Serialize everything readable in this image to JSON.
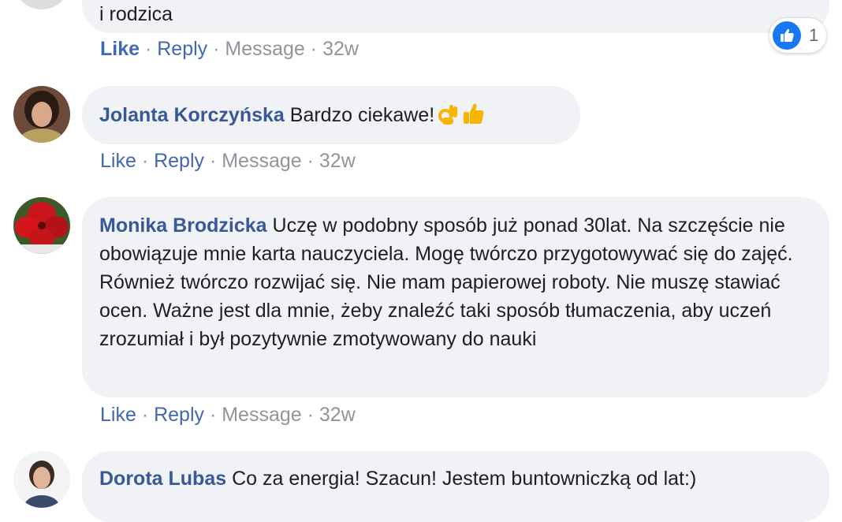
{
  "comments": [
    {
      "text": "i rodzica",
      "actions": {
        "like": "Like",
        "reply": "Reply",
        "message": "Message",
        "time": "32w"
      },
      "reactions": {
        "icon": "like-icon",
        "count": "1"
      }
    },
    {
      "author": "Jolanta Korczyńska",
      "text": "Bardzo ciekawe!",
      "emojis": [
        "ok-hand-emoji",
        "thumbs-up-emoji"
      ],
      "actions": {
        "like": "Like",
        "reply": "Reply",
        "message": "Message",
        "time": "32w"
      }
    },
    {
      "author": "Monika Brodzicka",
      "text": "Uczę w podobny sposób już ponad 30lat. Na szczęście nie obowiązuje mnie karta nauczyciela. Mogę twórczo przygotowywać się do zajęć. Również twórczo rozwijać się. Nie mam papierowej roboty. Nie muszę stawiać ocen. Ważne jest dla mnie, żeby znaleźć taki sposób tłumaczenia, aby uczeń zrozumiał i był pozytywnie zmotywowany do nauki",
      "actions": {
        "like": "Like",
        "reply": "Reply",
        "message": "Message",
        "time": "32w"
      }
    },
    {
      "author": "Dorota Lubas",
      "text": "Co za energia! Szacun! Jestem buntowniczką od lat:)"
    }
  ],
  "separator": " · ",
  "colors": {
    "link": "#385898",
    "action": "#4267b2",
    "muted": "#90949c",
    "bubble": "#f0f2f5",
    "like_blue": "#1877f2"
  }
}
